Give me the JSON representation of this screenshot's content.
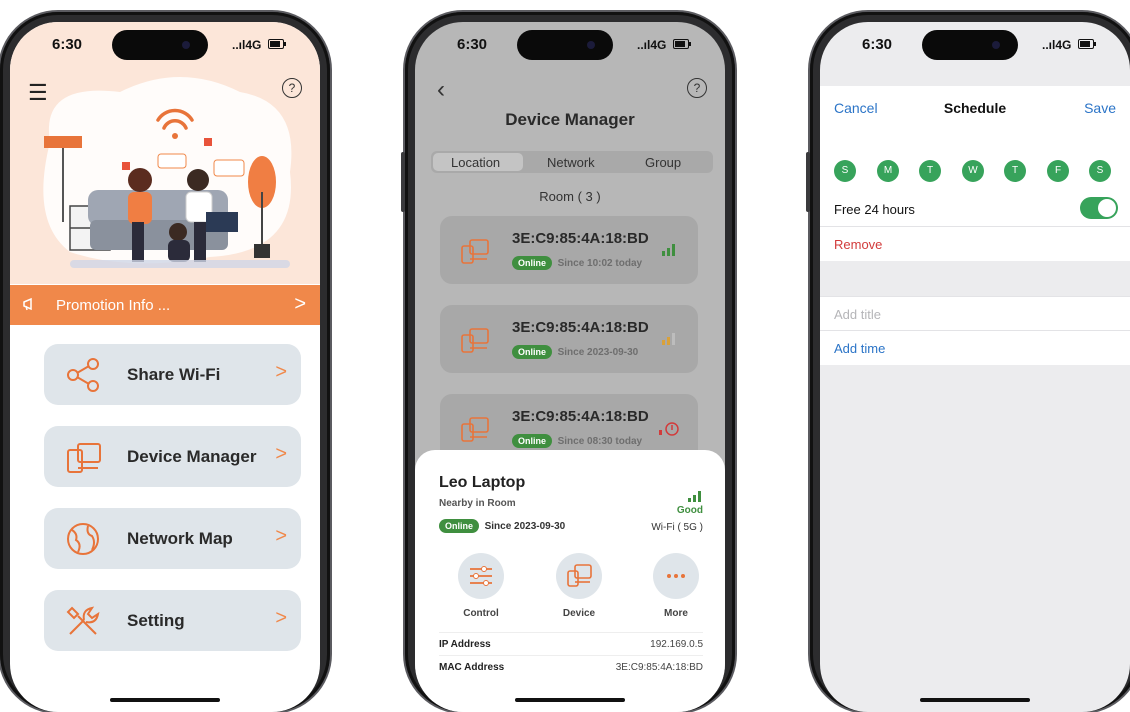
{
  "status_bar": {
    "time": "6:30",
    "signal": "..ıl4G"
  },
  "phone1": {
    "promo": {
      "label": "Promotion Info ...",
      "chevron": ">"
    },
    "menu": [
      {
        "label": "Share Wi-Fi",
        "icon": "share-icon",
        "chevron": ">"
      },
      {
        "label": "Device Manager",
        "icon": "device-icon",
        "chevron": ">"
      },
      {
        "label": "Network Map",
        "icon": "globe-icon",
        "chevron": ">"
      },
      {
        "label": "Setting",
        "icon": "tools-icon",
        "chevron": ">"
      }
    ],
    "help_icon": "?"
  },
  "phone2": {
    "title": "Device Manager",
    "help_icon": "?",
    "tabs": [
      "Location",
      "Network",
      "Group"
    ],
    "room_label": "Room ( 3 )",
    "devices": [
      {
        "mac": "3E:C9:85:4A:18:BD",
        "status": "Online",
        "since": "Since 10:02 today",
        "signal_color": "#3f8f3f"
      },
      {
        "mac": "3E:C9:85:4A:18:BD",
        "status": "Online",
        "since": "Since 2023-09-30",
        "signal_color": "#d9a13a"
      },
      {
        "mac": "3E:C9:85:4A:18:BD",
        "status": "Online",
        "since": "Since 08:30 today",
        "signal_color": "#d23b3b"
      }
    ],
    "sheet": {
      "name": "Leo Laptop",
      "location": "Nearby in Room",
      "status": "Online",
      "since": "Since 2023-09-30",
      "quality": "Good",
      "band": "Wi-Fi ( 5G )",
      "actions": [
        {
          "label": "Control",
          "icon": "sliders-icon"
        },
        {
          "label": "Device",
          "icon": "device-icon"
        },
        {
          "label": "More",
          "icon": "more-icon"
        }
      ],
      "info": [
        {
          "key": "IP Address",
          "value": "192.169.0.5"
        },
        {
          "key": "MAC Address",
          "value": "3E:C9:85:4A:18:BD"
        }
      ]
    }
  },
  "phone3": {
    "nav": {
      "cancel": "Cancel",
      "title": "Schedule",
      "save": "Save"
    },
    "days": [
      "S",
      "M",
      "T",
      "W",
      "T",
      "F",
      "S"
    ],
    "free_label": "Free 24 hours",
    "free_enabled": true,
    "remove_label": "Remove",
    "add_title_placeholder": "Add title",
    "add_time_label": "Add time"
  },
  "colors": {
    "accent_orange": "#f0884a",
    "online_green": "#3f8f3f",
    "link_blue": "#2b74c7",
    "danger_red": "#d23b3b"
  }
}
